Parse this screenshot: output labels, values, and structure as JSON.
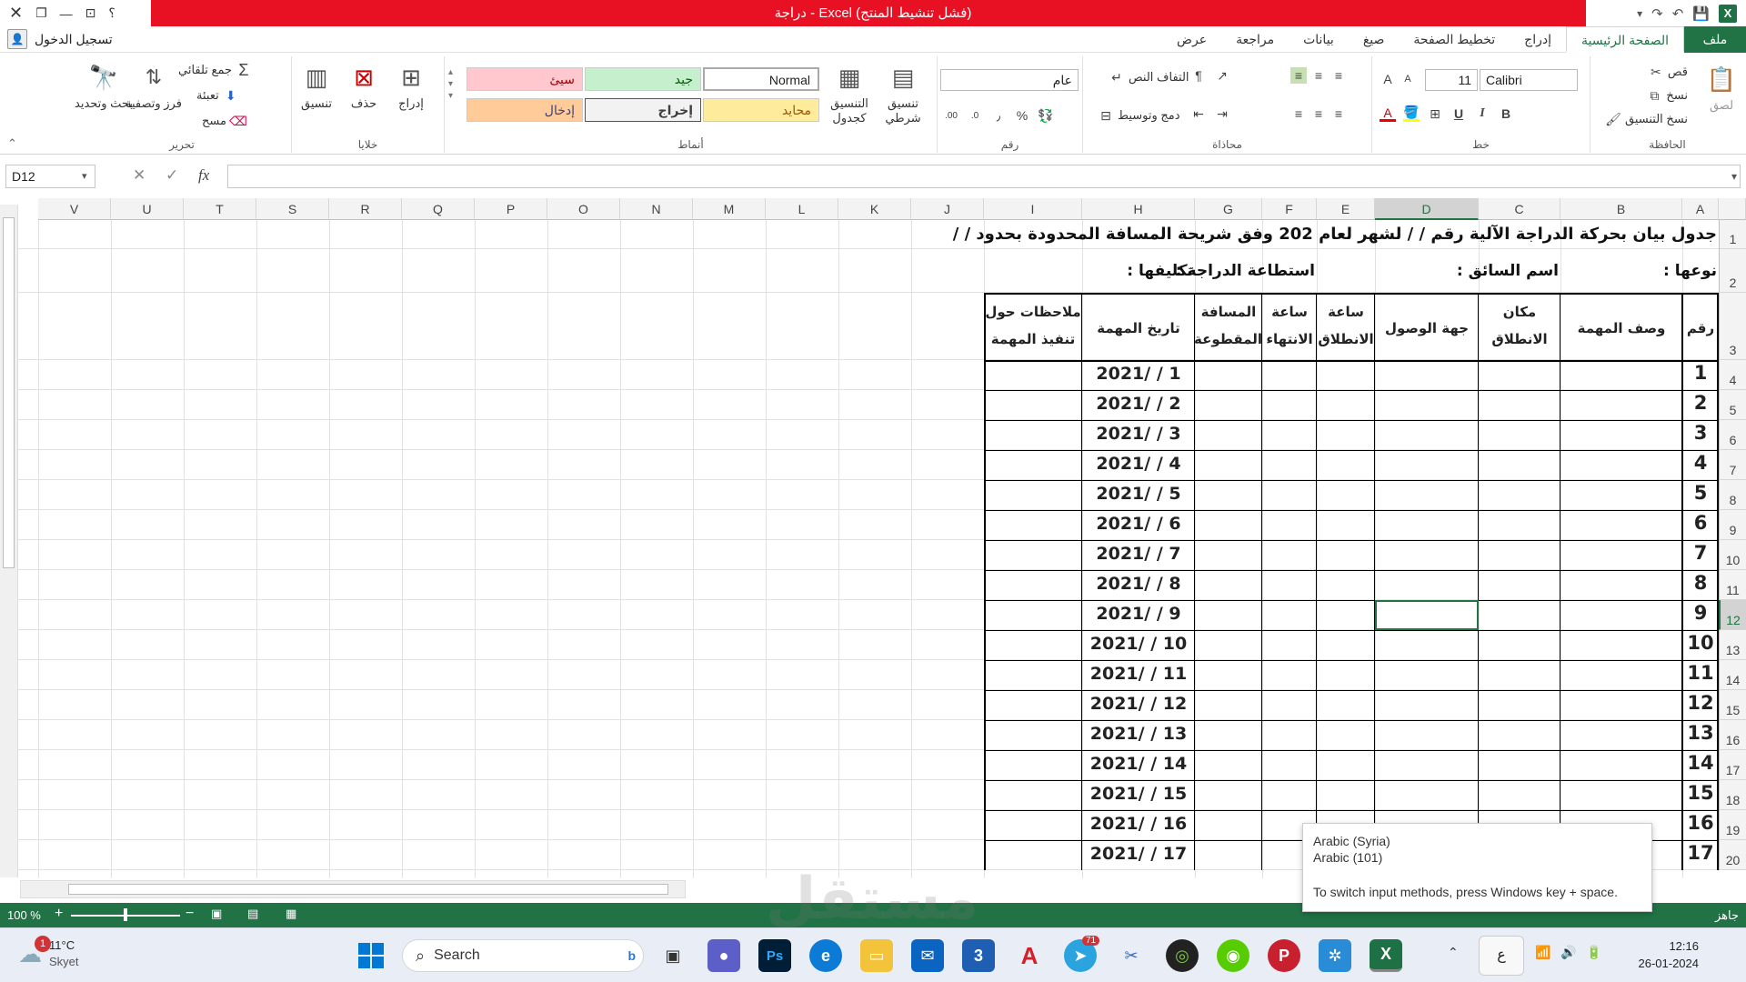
{
  "titlebar": {
    "title": "دراجة  -  Excel (فشل تنشيط المنتج)",
    "help": "؟"
  },
  "account": {
    "signin": "تسجيل الدخول"
  },
  "tabs": [
    "ملف",
    "الصفحة الرئيسية",
    "إدراج",
    "تخطيط الصفحة",
    "صيغ",
    "بيانات",
    "مراجعة",
    "عرض"
  ],
  "ribbon": {
    "clipboard": {
      "label": "الحافظة",
      "paste": "لصق",
      "cut": "قص",
      "copy": "نسخ",
      "format_painter": "نسخ التنسيق"
    },
    "font": {
      "label": "خط",
      "name": "Calibri",
      "size": "11",
      "bold": "B",
      "italic": "I",
      "underline": "U"
    },
    "alignment": {
      "label": "محاذاة",
      "wrap": "التفاف النص",
      "merge": "دمج وتوسيط"
    },
    "number": {
      "label": "رقم",
      "format": "عام",
      "percent": "%",
      "comma": "٫"
    },
    "styles": {
      "label": "أنماط",
      "conditional": "تنسيق شرطي",
      "as_table": "التنسيق كجدول",
      "normal": "Normal",
      "good": "جيد",
      "bad": "سيئ",
      "neutral": "محايد",
      "output": "إخراج",
      "input": "إدخال"
    },
    "cells": {
      "label": "خلايا",
      "insert": "إدراج",
      "delete": "حذف",
      "format": "تنسيق"
    },
    "editing": {
      "label": "تحرير",
      "autosum": "جمع تلقائي",
      "fill": "تعبئة",
      "clear": "مسح",
      "sort": "فرز وتصفية",
      "find": "بحث وتحديد"
    }
  },
  "formula_bar": {
    "name_box": "D12",
    "fx": "fx",
    "value": ""
  },
  "columns": [
    "A",
    "B",
    "C",
    "D",
    "E",
    "F",
    "G",
    "H",
    "I",
    "J",
    "K",
    "L",
    "M",
    "N",
    "O",
    "P",
    "Q",
    "R",
    "S",
    "T",
    "U",
    "V"
  ],
  "rows": [
    "1",
    "2",
    "3",
    "4",
    "5",
    "6",
    "7",
    "8",
    "9",
    "10",
    "11",
    "12",
    "13",
    "14",
    "15",
    "16",
    "17",
    "18",
    "19",
    "20"
  ],
  "sheet": {
    "row1": "جدول بيان بحركة الدراجة الآلية رقم  /          / لشهر      لعام  202  وفق شريحة المسافة المحدودة بحدود  /     /",
    "row2_type": "نوعها :",
    "row2_driver": "اسم السائق  :",
    "row2_capacity": "استطاعة الدراجة  :",
    "row2_assign": "تكليفها  :",
    "headers": {
      "num": "رقم",
      "desc": "وصف المهمة",
      "start_place": [
        "مكان",
        "الانطلاق"
      ],
      "dest": "جهة الوصول",
      "start_time": [
        "ساعة",
        "الانطلاق"
      ],
      "end_time": [
        "ساعة",
        "الانتهاء"
      ],
      "distance": [
        "المسافة",
        "المقطوعة"
      ],
      "date": "تاريخ المهمة",
      "notes": [
        "ملاحظات حول",
        "تنفيذ المهمة"
      ]
    },
    "numbers": [
      "1",
      "2",
      "3",
      "4",
      "5",
      "6",
      "7",
      "8",
      "9",
      "10",
      "11",
      "12",
      "13",
      "14",
      "15",
      "16",
      "17"
    ],
    "dates": [
      "1 /     /2021",
      "2 /     /2021",
      "3 /     /2021",
      "4 /     /2021",
      "5 /     /2021",
      "6 /     /2021",
      "7 /     /2021",
      "8 /     /2021",
      "9 /     /2021",
      "10 /     /2021",
      "11 /     /2021",
      "12 /     /2021",
      "13 /     /2021",
      "14 /     /2021",
      "15 /     /2021",
      "16 /     /2021",
      "17 /     /2021"
    ]
  },
  "status": {
    "ready": "جاهز",
    "zoom": "100 %"
  },
  "tooltip": {
    "line1": "Arabic (Syria)",
    "line2": "Arabic (101)",
    "line3": "To switch input methods, press Windows key + space."
  },
  "taskbar": {
    "weather_temp": "11°C",
    "weather_desc": "Skyet",
    "weather_badge": "1",
    "search": "Search",
    "lang": "ع",
    "time": "12:16",
    "date": "26-01-2024",
    "telegram_badge": "71"
  },
  "watermark": "مستقل"
}
